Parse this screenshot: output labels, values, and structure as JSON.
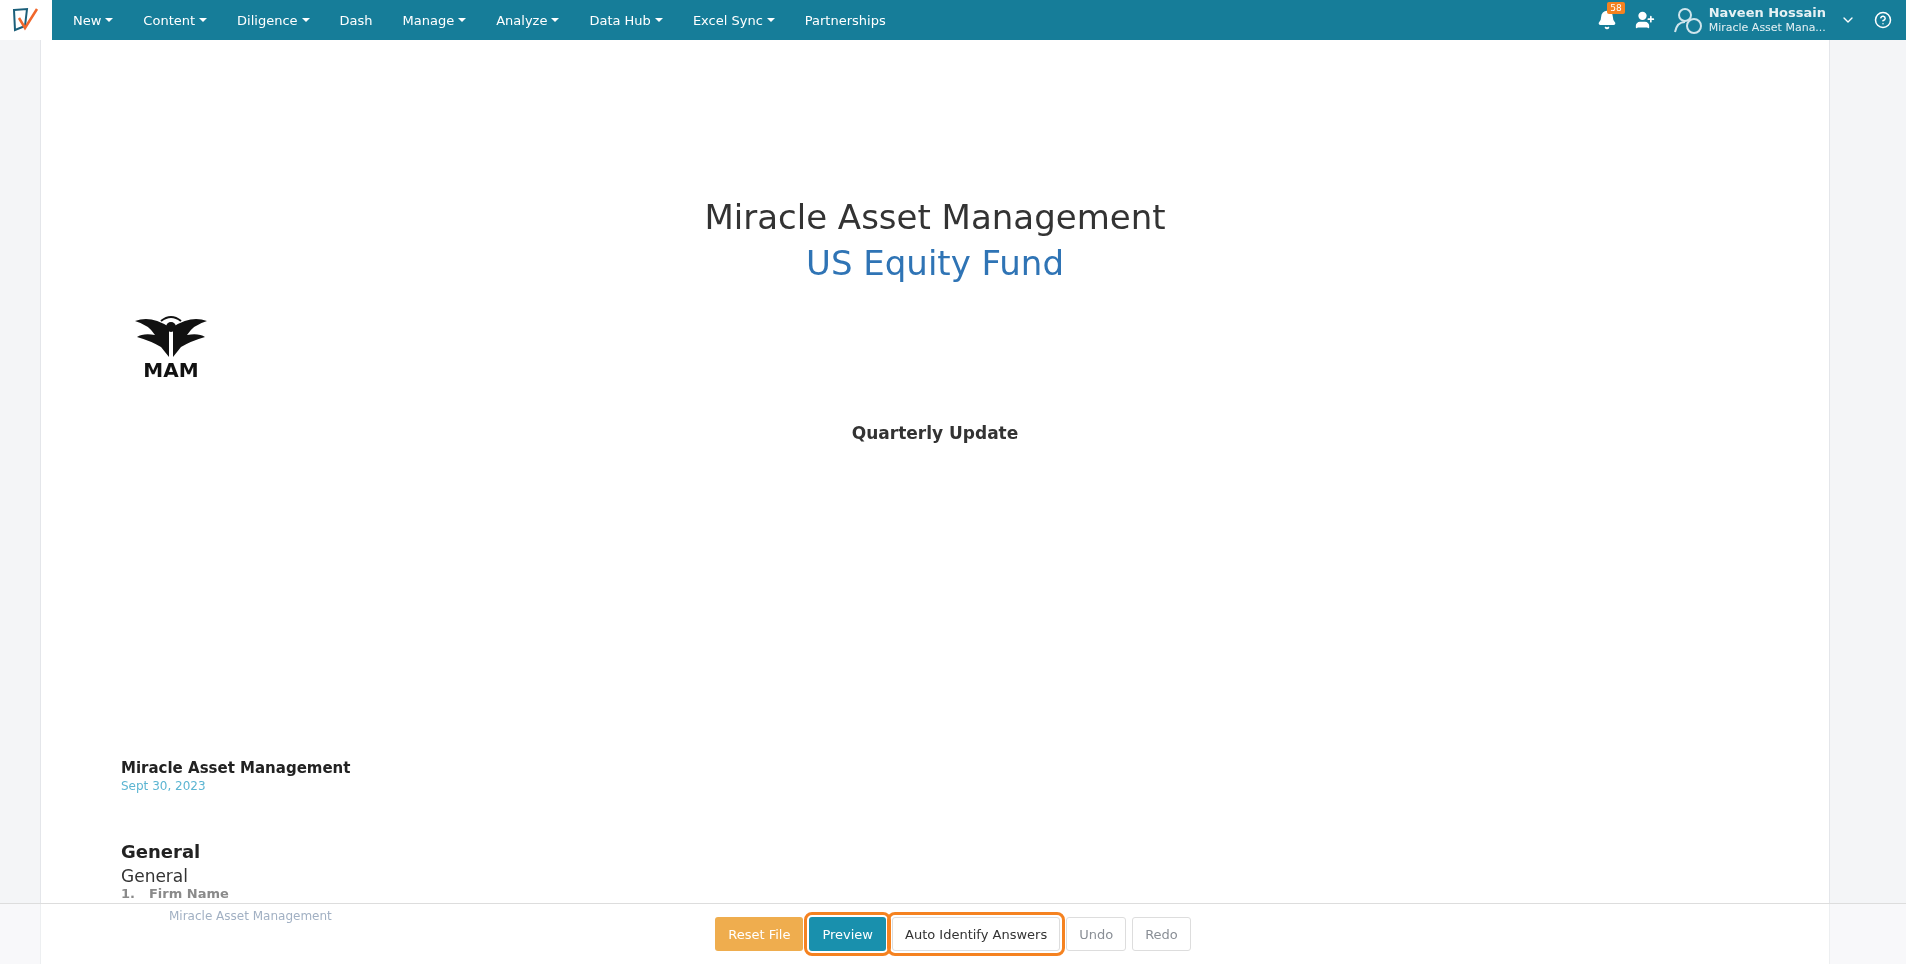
{
  "nav": {
    "items": [
      {
        "label": "New",
        "dropdown": true
      },
      {
        "label": "Content",
        "dropdown": true
      },
      {
        "label": "Diligence",
        "dropdown": true
      },
      {
        "label": "Dash",
        "dropdown": false
      },
      {
        "label": "Manage",
        "dropdown": true
      },
      {
        "label": "Analyze",
        "dropdown": true
      },
      {
        "label": "Data Hub",
        "dropdown": true
      },
      {
        "label": "Excel Sync",
        "dropdown": true
      },
      {
        "label": "Partnerships",
        "dropdown": false
      }
    ],
    "notifications": "58",
    "user": {
      "name": "Naveen Hossain",
      "org": "Miracle Asset Mana..."
    }
  },
  "document": {
    "company": "Miracle Asset Management",
    "fund": "US Equity Fund",
    "logo_text": "MAM",
    "report_title": "Quarterly Update",
    "issuer": "Miracle Asset Management",
    "date": "Sept 30, 2023",
    "section_heading": "General",
    "section_subheading": "General",
    "questions": [
      {
        "number": "1.",
        "label": "Firm Name",
        "answer": "Miracle Asset Management"
      }
    ]
  },
  "toolbar": {
    "buttons": [
      {
        "label": "Reset File",
        "kind": "warning",
        "highlighted": false,
        "disabled": false
      },
      {
        "label": "Preview",
        "kind": "primary",
        "highlighted": true,
        "disabled": false
      },
      {
        "label": "Auto Identify Answers",
        "kind": "default",
        "highlighted": true,
        "disabled": false
      },
      {
        "label": "Undo",
        "kind": "default",
        "highlighted": false,
        "disabled": true
      },
      {
        "label": "Redo",
        "kind": "default",
        "highlighted": false,
        "disabled": true
      }
    ]
  }
}
